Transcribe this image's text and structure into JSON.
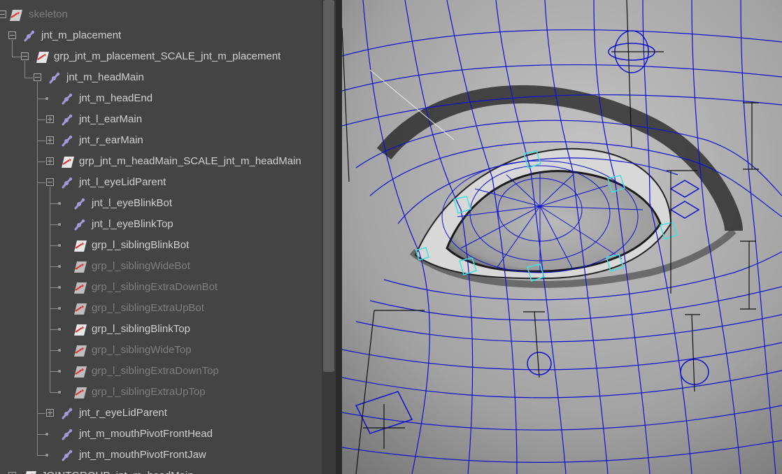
{
  "outliner": {
    "rows": [
      {
        "label": "skeleton",
        "icon": "transform-group-icon"
      },
      {
        "label": "jnt_m_placement",
        "icon": "joint-icon"
      },
      {
        "label": "grp_jnt_m_placement_SCALE_jnt_m_placement",
        "icon": "transform-group-icon"
      },
      {
        "label": "jnt_m_headMain",
        "icon": "joint-icon"
      },
      {
        "label": "jnt_m_headEnd",
        "icon": "joint-icon"
      },
      {
        "label": "jnt_l_earMain",
        "icon": "joint-icon"
      },
      {
        "label": "jnt_r_earMain",
        "icon": "joint-icon"
      },
      {
        "label": "grp_jnt_m_headMain_SCALE_jnt_m_headMain",
        "icon": "transform-group-icon"
      },
      {
        "label": "jnt_l_eyeLidParent",
        "icon": "joint-icon"
      },
      {
        "label": "jnt_l_eyeBlinkBot",
        "icon": "joint-icon"
      },
      {
        "label": "jnt_l_eyeBlinkTop",
        "icon": "joint-icon"
      },
      {
        "label": "grp_l_siblingBlinkBot",
        "icon": "transform-group-icon"
      },
      {
        "label": "grp_l_siblingWideBot",
        "icon": "transform-group-icon"
      },
      {
        "label": "grp_l_siblingExtraDownBot",
        "icon": "transform-group-icon"
      },
      {
        "label": "grp_l_siblingExtraUpBot",
        "icon": "transform-group-icon"
      },
      {
        "label": "grp_l_siblingBlinkTop",
        "icon": "transform-group-icon"
      },
      {
        "label": "grp_l_siblingWideTop",
        "icon": "transform-group-icon"
      },
      {
        "label": "grp_l_siblingExtraDownTop",
        "icon": "transform-group-icon"
      },
      {
        "label": "grp_l_siblingExtraUpTop",
        "icon": "transform-group-icon"
      },
      {
        "label": "jnt_r_eyeLidParent",
        "icon": "joint-icon"
      },
      {
        "label": "jnt_m_mouthPivotFrontHead",
        "icon": "joint-icon"
      },
      {
        "label": "jnt_m_mouthPivotFrontJaw",
        "icon": "joint-icon"
      },
      {
        "label": "JOINTGROUP_jnt_m_headMain",
        "icon": "transform-group-icon"
      }
    ]
  },
  "colors": {
    "panel_bg": "#444444",
    "text": "#d0d0d0",
    "text_dim": "#7e7e7e",
    "joint_icon": "#a59ad9",
    "group_icon_arrow": "#e03030",
    "wire_blue": "#1010d0",
    "wire_cyan": "#40e0e0"
  }
}
